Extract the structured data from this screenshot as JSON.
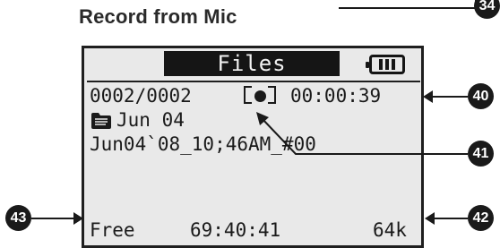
{
  "section_title": "Record from Mic",
  "callouts": {
    "c34": "34",
    "c40": "40",
    "c41": "41",
    "c42": "42",
    "c43": "43"
  },
  "screen": {
    "title": "Files",
    "counter": "0002/0002",
    "elapsed": "00:00:39",
    "folder_name": "Jun 04",
    "file_name": "Jun04`08_10;46AM_#00",
    "free_label": "Free",
    "free_time": "69:40:41",
    "bitrate": "64k"
  },
  "icons": {
    "record": "record-indicator-icon",
    "folder": "folder-icon",
    "battery": "battery-full-icon"
  },
  "colors": {
    "lcd_background": "#e9e9e9",
    "ink": "#1a1a1a"
  }
}
